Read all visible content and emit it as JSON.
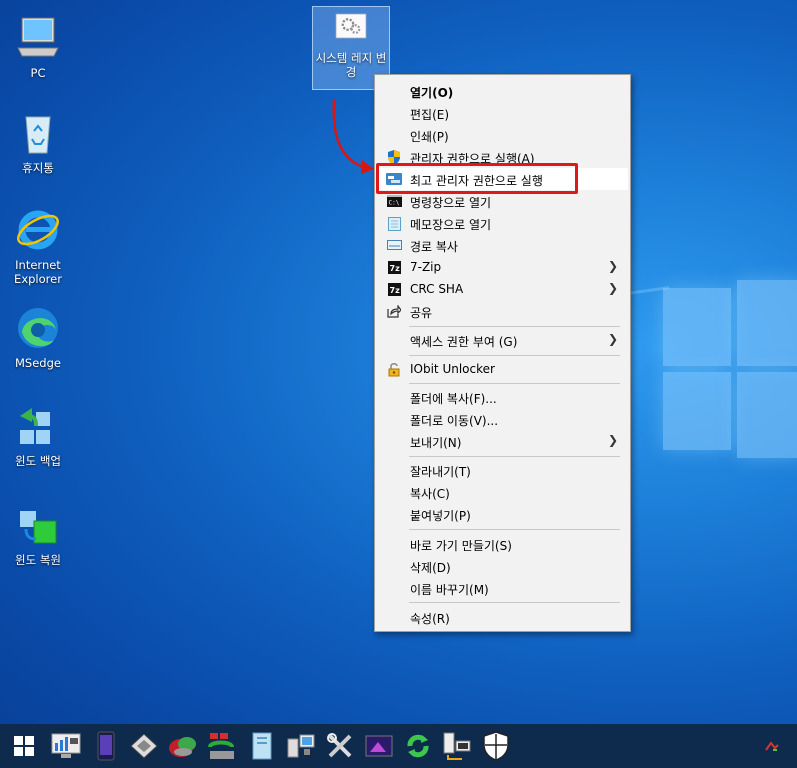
{
  "desktop": {
    "icons": [
      {
        "label": "PC"
      },
      {
        "label": "휴지통"
      },
      {
        "label": "Internet Explorer"
      },
      {
        "label": "MSedge"
      },
      {
        "label": "윈도 백업"
      },
      {
        "label": "윈도 복원"
      }
    ],
    "selected_file": {
      "label": "시스템 레지 변경"
    }
  },
  "context_menu": {
    "items": [
      {
        "label": "열기(O)"
      },
      {
        "label": "편집(E)"
      },
      {
        "label": "인쇄(P)"
      },
      {
        "label": "관리자 권한으로 실행(A)"
      },
      {
        "label": "최고 관리자 권한으로 실행"
      },
      {
        "label": "명령창으로 열기"
      },
      {
        "label": "메모장으로 열기"
      },
      {
        "label": "경로 복사"
      },
      {
        "label": "7-Zip"
      },
      {
        "label": "CRC SHA"
      },
      {
        "label": "공유"
      },
      {
        "label": "액세스 권한 부여 (G)"
      },
      {
        "label": "IObit Unlocker"
      },
      {
        "label": "폴더에 복사(F)..."
      },
      {
        "label": "폴더로 이동(V)..."
      },
      {
        "label": "보내기(N)"
      },
      {
        "label": "잘라내기(T)"
      },
      {
        "label": "복사(C)"
      },
      {
        "label": "붙여넣기(P)"
      },
      {
        "label": "바로 가기 만들기(S)"
      },
      {
        "label": "삭제(D)"
      },
      {
        "label": "이름 바꾸기(M)"
      },
      {
        "label": "속성(R)"
      }
    ]
  },
  "taskbar": {
    "items": [
      "start-icon",
      "system-monitor-icon",
      "phone-icon",
      "disk-tool-icon",
      "recovery-icon",
      "transfer-icon",
      "document-icon",
      "network-icon",
      "tools-icon",
      "media-icon",
      "refresh-icon",
      "device-icon",
      "shield-icon"
    ]
  },
  "colors": {
    "highlight_border": "#e01818",
    "menu_bg": "#f2f2f2",
    "taskbar_bg": "#0e2b4e"
  }
}
